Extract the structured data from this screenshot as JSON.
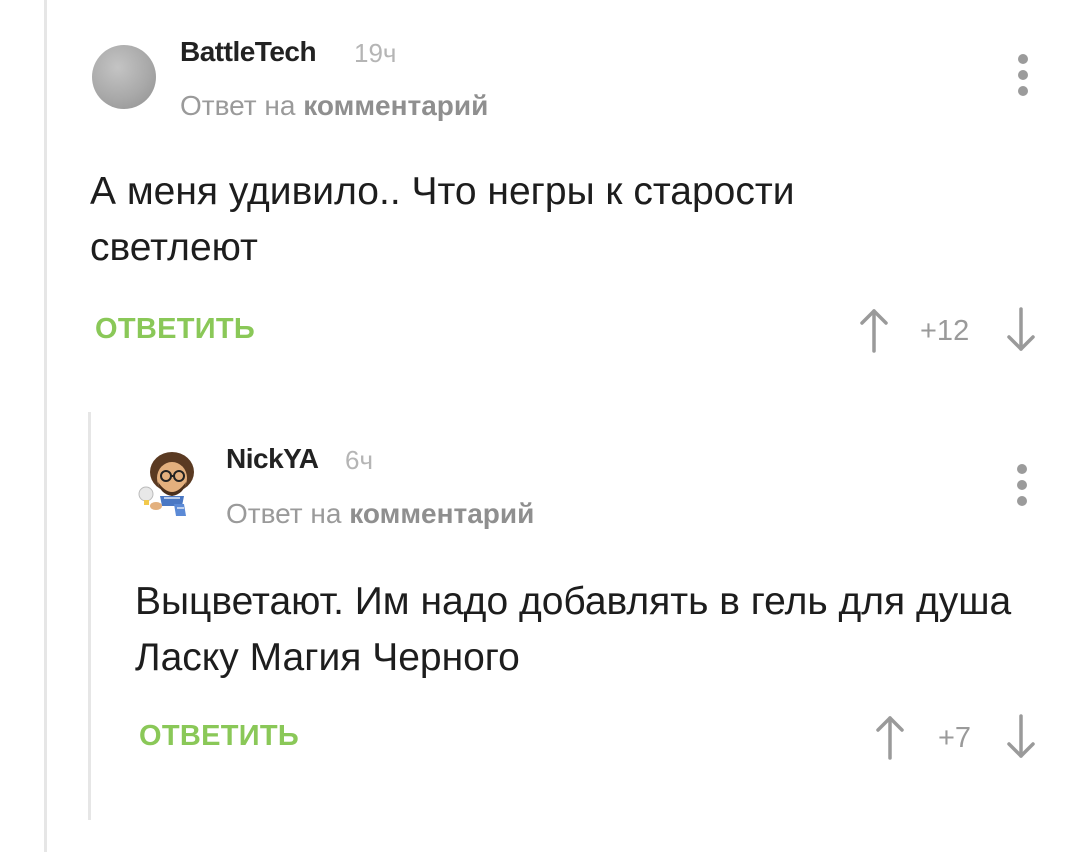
{
  "comments": [
    {
      "author": "BattleTech",
      "time": "19ч",
      "reply_prefix": "Ответ на",
      "reply_link": "комментарий",
      "text": "А меня удивило.. Что негры к старости светлеют",
      "reply_label": "ОТВЕТИТЬ",
      "rating": "+12"
    },
    {
      "author": "NickYA",
      "time": "6ч",
      "reply_prefix": "Ответ на",
      "reply_link": "комментарий",
      "text": "Выцветают. Им надо добавлять в гель для душа Ласку Магия Черного",
      "reply_label": "ОТВЕТИТЬ",
      "rating": "+7"
    }
  ],
  "colors": {
    "accent_green": "#8ac858",
    "muted_gray": "#9a9a9a",
    "thread_line": "#e6e6e6"
  },
  "icons": [
    "kebab-menu-icon",
    "arrow-up-icon",
    "arrow-down-icon"
  ]
}
